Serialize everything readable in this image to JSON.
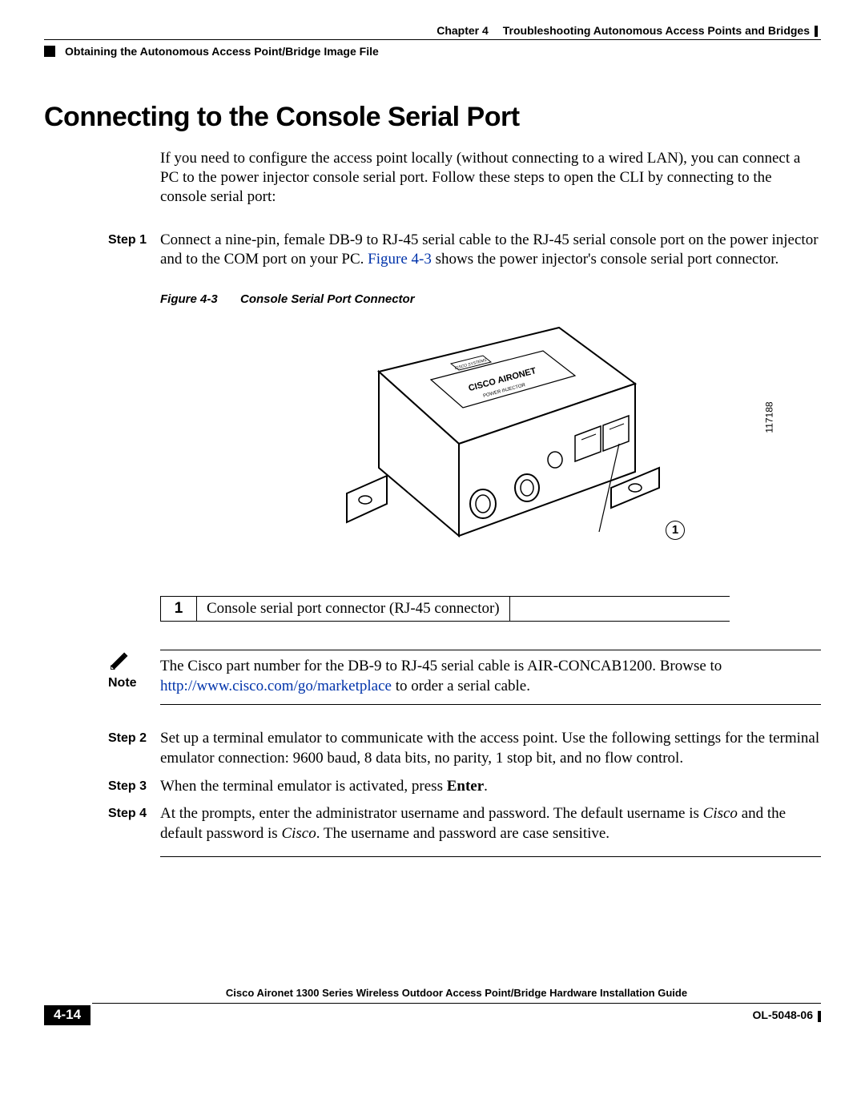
{
  "header": {
    "chapter_label": "Chapter 4",
    "chapter_title": "Troubleshooting Autonomous Access Points and Bridges",
    "section_title": "Obtaining the Autonomous Access Point/Bridge Image File"
  },
  "heading": "Connecting to the Console Serial Port",
  "intro": "If you need to configure the access point locally (without connecting to a wired LAN), you can connect a PC to the power injector console serial port. Follow these steps to open the CLI by connecting to the console serial port:",
  "steps": {
    "step1": {
      "label": "Step 1",
      "pre": "Connect a nine-pin, female DB-9 to RJ-45 serial cable to the RJ-45 serial console port on the power injector and to the COM port on your PC. ",
      "link": "Figure 4-3",
      "post": " shows the power injector's console serial port connector."
    },
    "step2": {
      "label": "Step 2",
      "text": "Set up a terminal emulator to communicate with the access point. Use the following settings for the terminal emulator connection: 9600 baud, 8 data bits, no parity, 1 stop bit, and no flow control."
    },
    "step3": {
      "label": "Step 3",
      "pre": "When the terminal emulator is activated, press ",
      "enter": "Enter",
      "post": "."
    },
    "step4": {
      "label": "Step 4",
      "pre": "At the prompts, enter the administrator username and password. The default username is ",
      "u": "Cisco",
      "mid": " and the default password is ",
      "p": "Cisco",
      "post": ". The username and password are case sensitive."
    }
  },
  "figure": {
    "num": "Figure 4-3",
    "title": "Console Serial Port Connector",
    "callout_num": "1",
    "drawing_id": "117188",
    "label_text": "CISCO AIRONET",
    "sub_label": "POWER INJECTOR",
    "logo_text": "CISCO SYSTEMS"
  },
  "legend": {
    "num": "1",
    "text": "Console serial port connector (RJ-45 connector)"
  },
  "note": {
    "label": "Note",
    "pre": "The Cisco part number for the DB-9 to RJ-45 serial cable is AIR-CONCAB1200. Browse to ",
    "link": "http://www.cisco.com/go/marketplace",
    "post": " to order a serial cable."
  },
  "footer": {
    "guide": "Cisco Aironet 1300 Series Wireless Outdoor Access Point/Bridge Hardware Installation Guide",
    "page": "4-14",
    "doc": "OL-5048-06"
  }
}
